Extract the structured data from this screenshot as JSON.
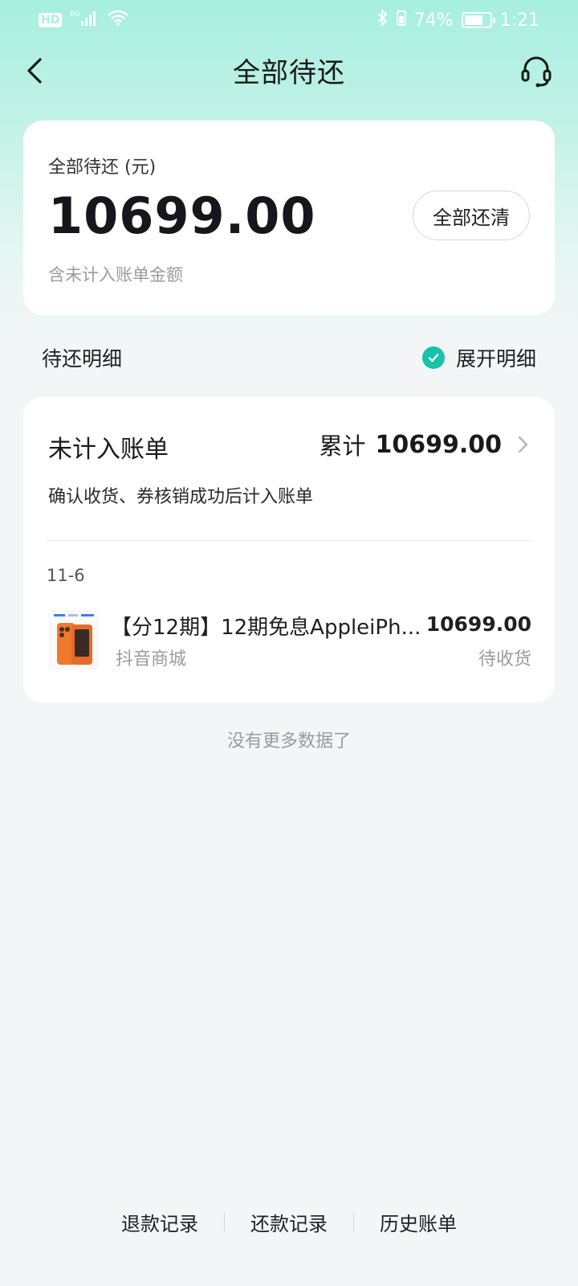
{
  "status_bar": {
    "left_icons": [
      "hd-icon",
      "signal-6g-icon",
      "wifi-icon"
    ],
    "hd_label": "HD",
    "network": "6G",
    "bluetooth_icon": "bluetooth-icon",
    "battery_percent": "74%",
    "battery_level": 0.74,
    "time": "1:21",
    "text_color": "#ffffff"
  },
  "nav": {
    "back_icon": "chevron-left-icon",
    "title": "全部待还",
    "service_icon": "headset-icon"
  },
  "summary": {
    "label": "全部待还 (元)",
    "amount": "10699.00",
    "note": "含未计入账单金额",
    "payoff_button": "全部还清"
  },
  "detail": {
    "title": "待还明细",
    "expand_label": "展开明细",
    "expand_checked": true,
    "check_color": "#17c3a9"
  },
  "bill": {
    "title": "未计入账单",
    "total_label": "累计",
    "total_value": "10699.00",
    "subtitle": "确认收货、券核销成功后计入账单",
    "date": "11-6",
    "items": [
      {
        "thumbnail_icon": "phone-product-thumbnail",
        "name": "【分12期】12期免息AppleiPh...",
        "store": "抖音商城",
        "amount": "10699.00",
        "status": "待收货"
      }
    ]
  },
  "no_more_text": "没有更多数据了",
  "footer": {
    "refund_records": "退款记录",
    "repay_records": "还款记录",
    "history_bills": "历史账单"
  },
  "colors": {
    "header_gradient_top": "#a6efe0",
    "page_background": "#f4f5f7",
    "accent": "#17c3a9",
    "product_orange": "#f07a2c"
  }
}
